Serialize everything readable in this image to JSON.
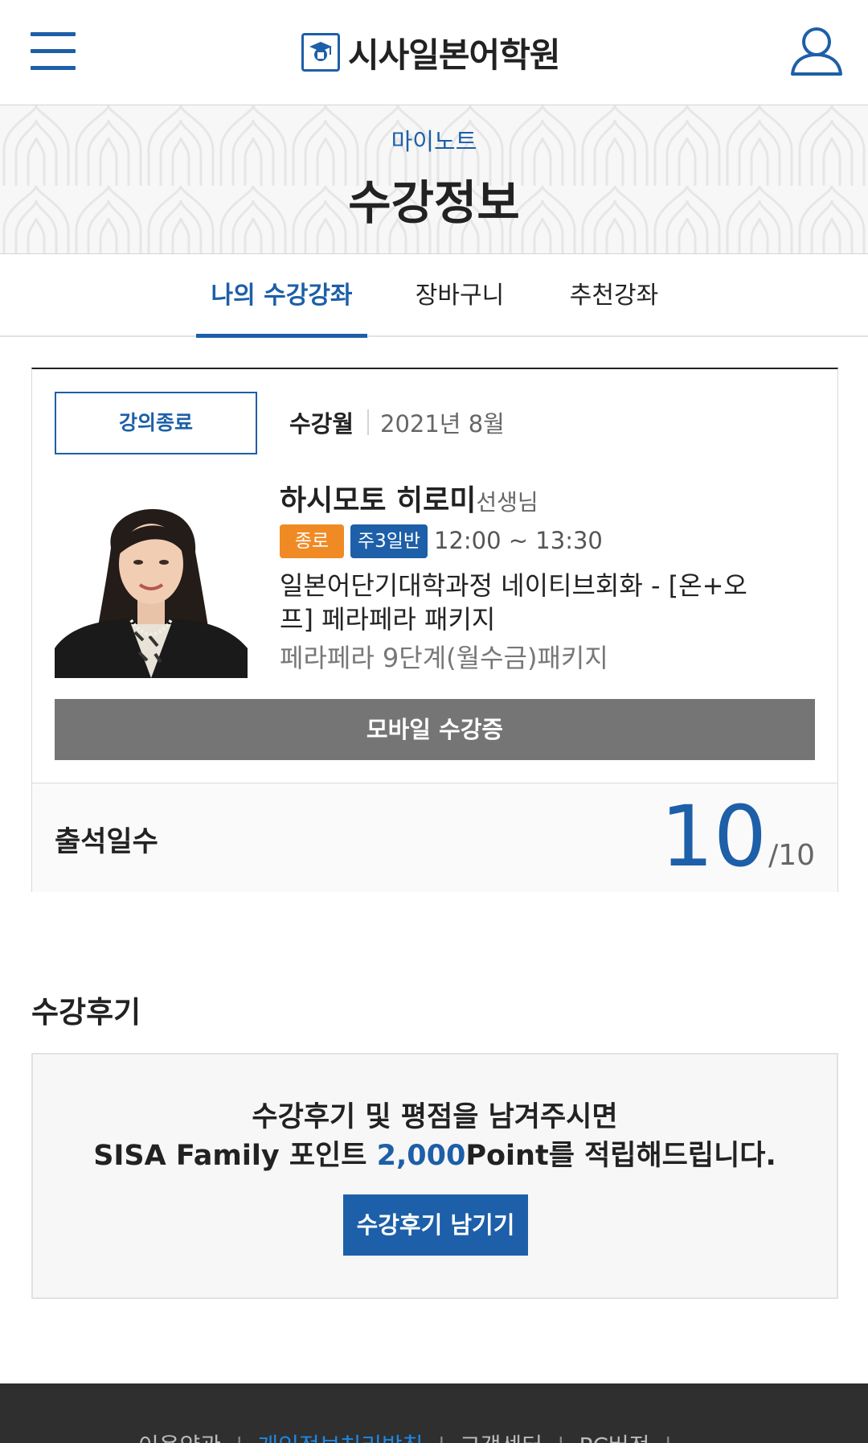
{
  "header": {
    "logo_text": "시사일본어학원",
    "menu_icon": "hamburger-menu-icon",
    "user_icon": "user-profile-icon",
    "accent_color": "#1d5fa8"
  },
  "title_band": {
    "breadcrumb": "마이노트",
    "title": "수강정보"
  },
  "tabs": [
    {
      "label": "나의 수강강좌",
      "active": true
    },
    {
      "label": "장바구니",
      "active": false
    },
    {
      "label": "추천강좌",
      "active": false
    }
  ],
  "course": {
    "status": "강의종료",
    "month_label": "수강월",
    "month_value": "2021년 8월",
    "teacher_name": "하시모토 히로미",
    "teacher_suffix": "선생님",
    "badge_location": "종로",
    "badge_schedule": "주3일반",
    "time": "12:00 ~ 13:30",
    "title": "일본어단기대학과정 네이티브회화 - [온+오프] 페라페라 패키지",
    "subtitle": "페라페라 9단계(월수금)패키지",
    "mobile_pass_label": "모바일 수강증",
    "attendance_label": "출석일수",
    "attendance_count": "10",
    "attendance_total": "/10"
  },
  "review": {
    "heading": "수강후기",
    "line1": "수강후기 및 평점을 남겨주시면",
    "line2_prefix": "SISA Family 포인트 ",
    "line2_points": "2,000",
    "line2_suffix": "Point를 적립해드립니다.",
    "button_label": "수강후기 남기기"
  },
  "footer": {
    "links": [
      "이용약관",
      "개인정보처리방침",
      "고객센터",
      "PC버전"
    ]
  }
}
